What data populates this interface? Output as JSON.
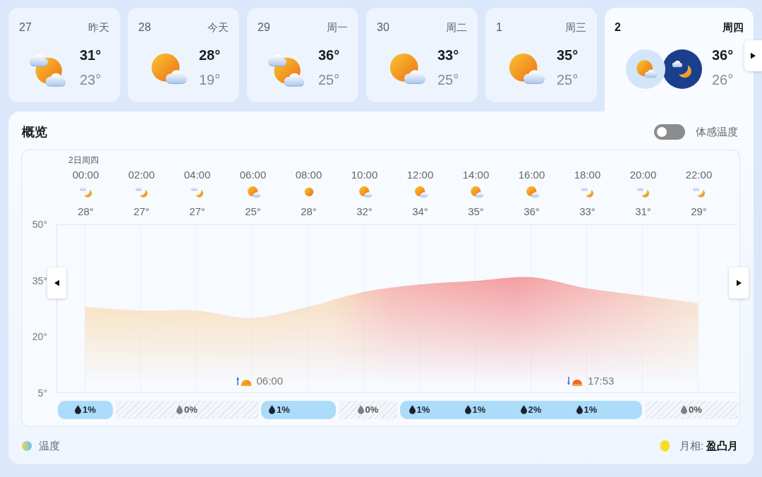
{
  "days": [
    {
      "date": "27",
      "label": "昨天",
      "icons": [
        {
          "kind": "cloudy"
        }
      ],
      "high": "31°",
      "low": "23°",
      "selected": false
    },
    {
      "date": "28",
      "label": "今天",
      "icons": [
        {
          "kind": "partly-cloudy"
        }
      ],
      "high": "28°",
      "low": "19°",
      "selected": false
    },
    {
      "date": "29",
      "label": "周一",
      "icons": [
        {
          "kind": "cloudy"
        }
      ],
      "high": "36°",
      "low": "25°",
      "selected": false
    },
    {
      "date": "30",
      "label": "周二",
      "icons": [
        {
          "kind": "partly-cloudy"
        }
      ],
      "high": "33°",
      "low": "25°",
      "selected": false
    },
    {
      "date": "1",
      "label": "周三",
      "icons": [
        {
          "kind": "partly-cloudy"
        }
      ],
      "high": "35°",
      "low": "25°",
      "selected": false
    },
    {
      "date": "2",
      "label": "周四",
      "icons": [
        {
          "kind": "partly-cloudy"
        },
        {
          "kind": "cloudy-night"
        }
      ],
      "high": "36°",
      "low": "26°",
      "selected": true
    }
  ],
  "overview": {
    "title": "概览",
    "feels_like": {
      "label": "体感温度",
      "on": false
    },
    "chart": {
      "date_label": "2日周四",
      "hourly": [
        {
          "kind": "cloudy-night",
          "temp": "28°"
        },
        {
          "kind": "cloudy-night",
          "temp": "27°"
        },
        {
          "kind": "cloudy-night",
          "temp": "27°"
        },
        {
          "kind": "partly-cloudy",
          "temp": "25°"
        },
        {
          "kind": "sunny",
          "temp": "28°"
        },
        {
          "kind": "partly-cloudy",
          "temp": "32°"
        },
        {
          "kind": "partly-cloudy",
          "temp": "34°"
        },
        {
          "kind": "partly-cloudy",
          "temp": "35°"
        },
        {
          "kind": "partly-cloudy",
          "temp": "36°"
        },
        {
          "kind": "cloudy-night",
          "temp": "33°"
        },
        {
          "kind": "cloudy-night",
          "temp": "31°"
        },
        {
          "kind": "cloudy-night",
          "temp": "29°"
        }
      ],
      "chart_data": {
        "type": "area",
        "categories": [
          "00:00",
          "02:00",
          "04:00",
          "06:00",
          "08:00",
          "10:00",
          "12:00",
          "14:00",
          "16:00",
          "18:00",
          "20:00",
          "22:00"
        ],
        "values": [
          28,
          27,
          27,
          25,
          28,
          32,
          34,
          35,
          36,
          33,
          31,
          29
        ],
        "ylim": [
          5,
          50
        ],
        "yticks": [
          {
            "value": 50,
            "label": "50°"
          },
          {
            "value": 35,
            "label": "35°"
          },
          {
            "value": 20,
            "label": "20°"
          },
          {
            "value": 5,
            "label": "5°"
          }
        ],
        "grid": true
      },
      "sun_events": [
        {
          "kind": "sunrise",
          "time": "06:00"
        },
        {
          "kind": "sunset",
          "time": "17:53"
        }
      ],
      "precipitation": [
        {
          "kind": "rain",
          "readings": [
            "1%"
          ]
        },
        {
          "kind": "dry",
          "readings": [
            "0%"
          ]
        },
        {
          "kind": "rain",
          "readings": [
            "1%"
          ]
        },
        {
          "kind": "dry",
          "readings": [
            "0%"
          ]
        },
        {
          "kind": "rain",
          "readings": [
            "1%",
            "1%",
            "2%",
            "1%"
          ]
        },
        {
          "kind": "dry",
          "readings": [
            "0%"
          ]
        }
      ]
    },
    "legend": {
      "label": "温度"
    },
    "moon_phase": "月相: **盈凸月**"
  }
}
